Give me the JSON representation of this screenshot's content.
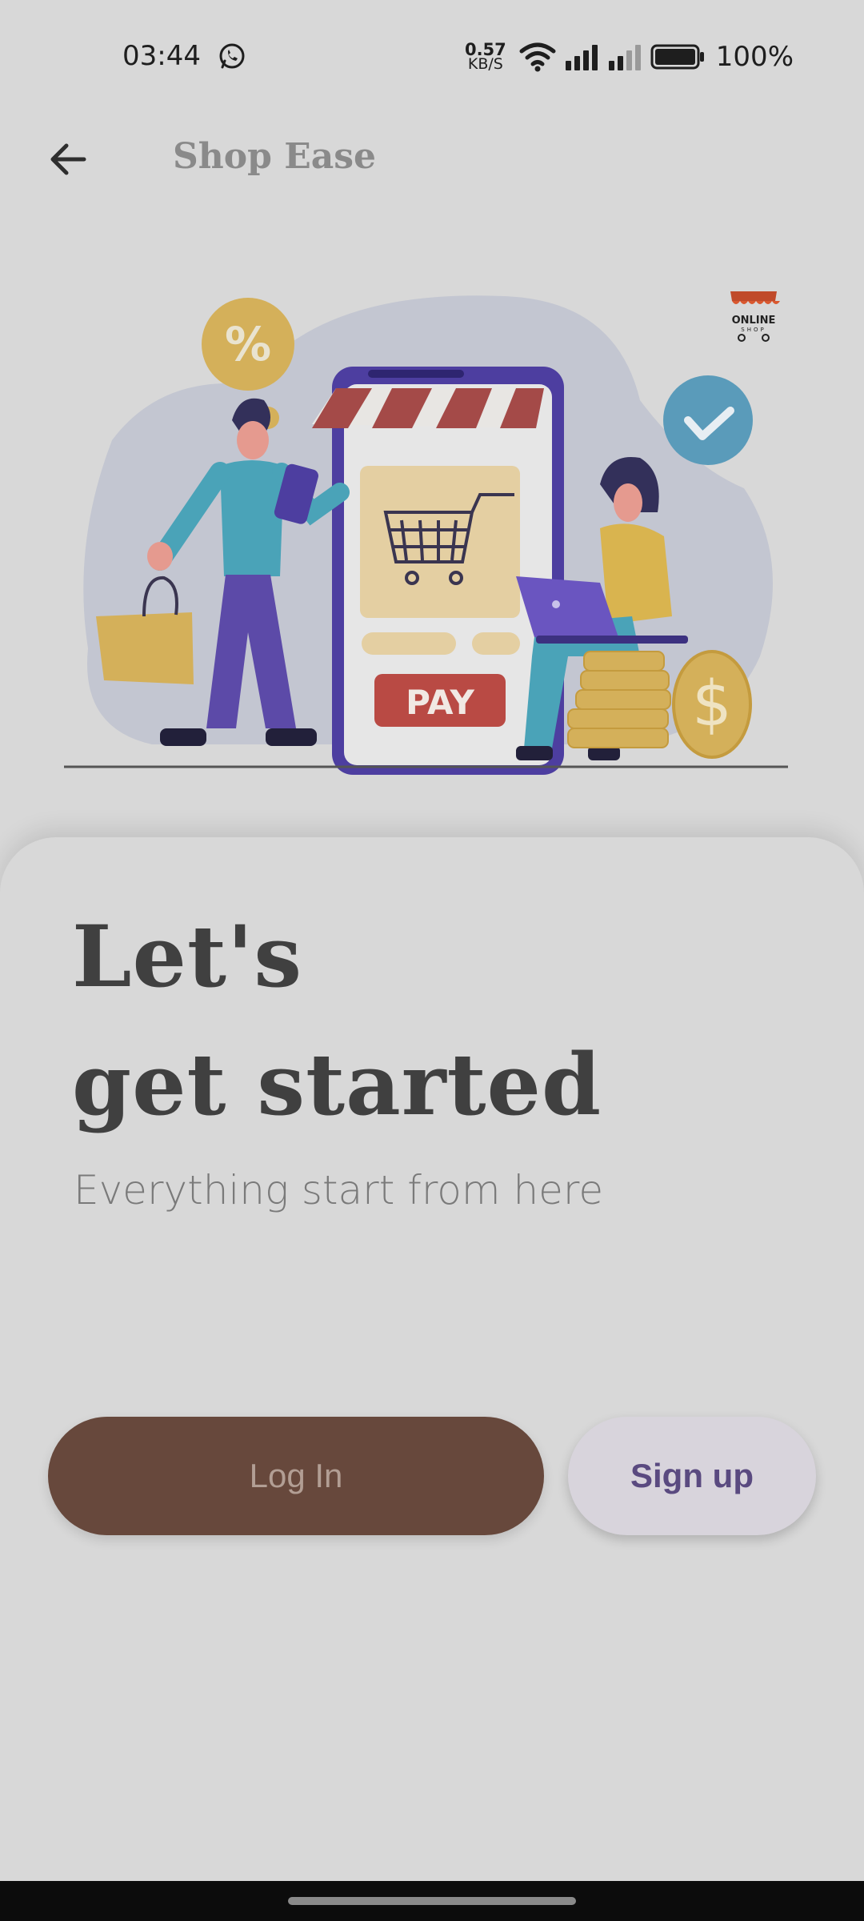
{
  "status_bar": {
    "time": "03:44",
    "net_speed_value": "0.57",
    "net_speed_unit": "KB/S",
    "battery_percent": "100%"
  },
  "app_bar": {
    "title": "Shop Ease"
  },
  "hero": {
    "pay_label": "PAY",
    "percent_label": "%",
    "logo_line1": "ONLINE",
    "logo_line2": "SHOP"
  },
  "onboarding": {
    "headline_line1": "Let's",
    "headline_line2": "get started",
    "subtitle": "Everything start from here"
  },
  "actions": {
    "login_label": "Log In",
    "signup_label": "Sign up"
  },
  "colors": {
    "background": "#d8d8d8",
    "login_button": "#67483c",
    "signup_button": "#d8d4dc",
    "signup_text": "#5a4a80"
  }
}
